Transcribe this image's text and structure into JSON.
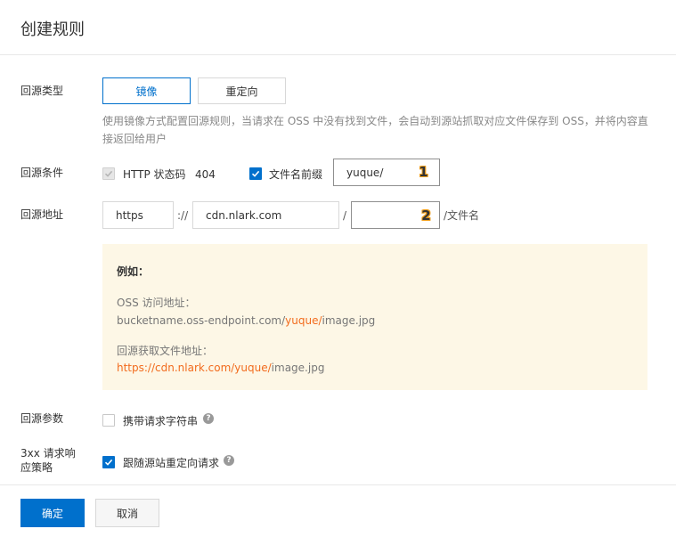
{
  "dialog": {
    "title": "创建规则"
  },
  "origin_type": {
    "label": "回源类型",
    "options": [
      "镜像",
      "重定向"
    ],
    "selected": "镜像",
    "description": "使用镜像方式配置回源规则，当请求在 OSS 中没有找到文件，会自动到源站抓取对应文件保存到 OSS，并将内容直接返回给用户"
  },
  "origin_condition": {
    "label": "回源条件",
    "http_status_label": "HTTP 状态码",
    "http_status_value": "404",
    "prefix_label": "文件名前缀",
    "prefix_value": "yuque/",
    "marker": "1"
  },
  "origin_address": {
    "label": "回源地址",
    "protocol": "https",
    "scheme_sep": "://",
    "host": "cdn.nlark.com",
    "slash": "/",
    "path": "",
    "marker": "2",
    "suffix": "/文件名"
  },
  "example": {
    "title": "例如：",
    "oss_label": "OSS 访问地址：",
    "oss_url_prefix": "bucketname.oss-endpoint.com/",
    "oss_url_highlight": "yuque/",
    "oss_url_suffix": "image.jpg",
    "origin_label": "回源获取文件地址：",
    "origin_url_highlight": "https://cdn.nlark.com/yuque/",
    "origin_url_suffix": "image.jpg"
  },
  "origin_params": {
    "label": "回源参数",
    "option": "携带请求字符串",
    "checked": false
  },
  "redirect_policy": {
    "label_line1": "3xx 请求响",
    "label_line2": "应策略",
    "option": "跟随源站重定向请求",
    "checked": true
  },
  "footer": {
    "confirm": "确定",
    "cancel": "取消"
  },
  "colors": {
    "primary": "#0070cc",
    "highlight": "#f26b1d",
    "example_bg": "#fdf7e6"
  }
}
